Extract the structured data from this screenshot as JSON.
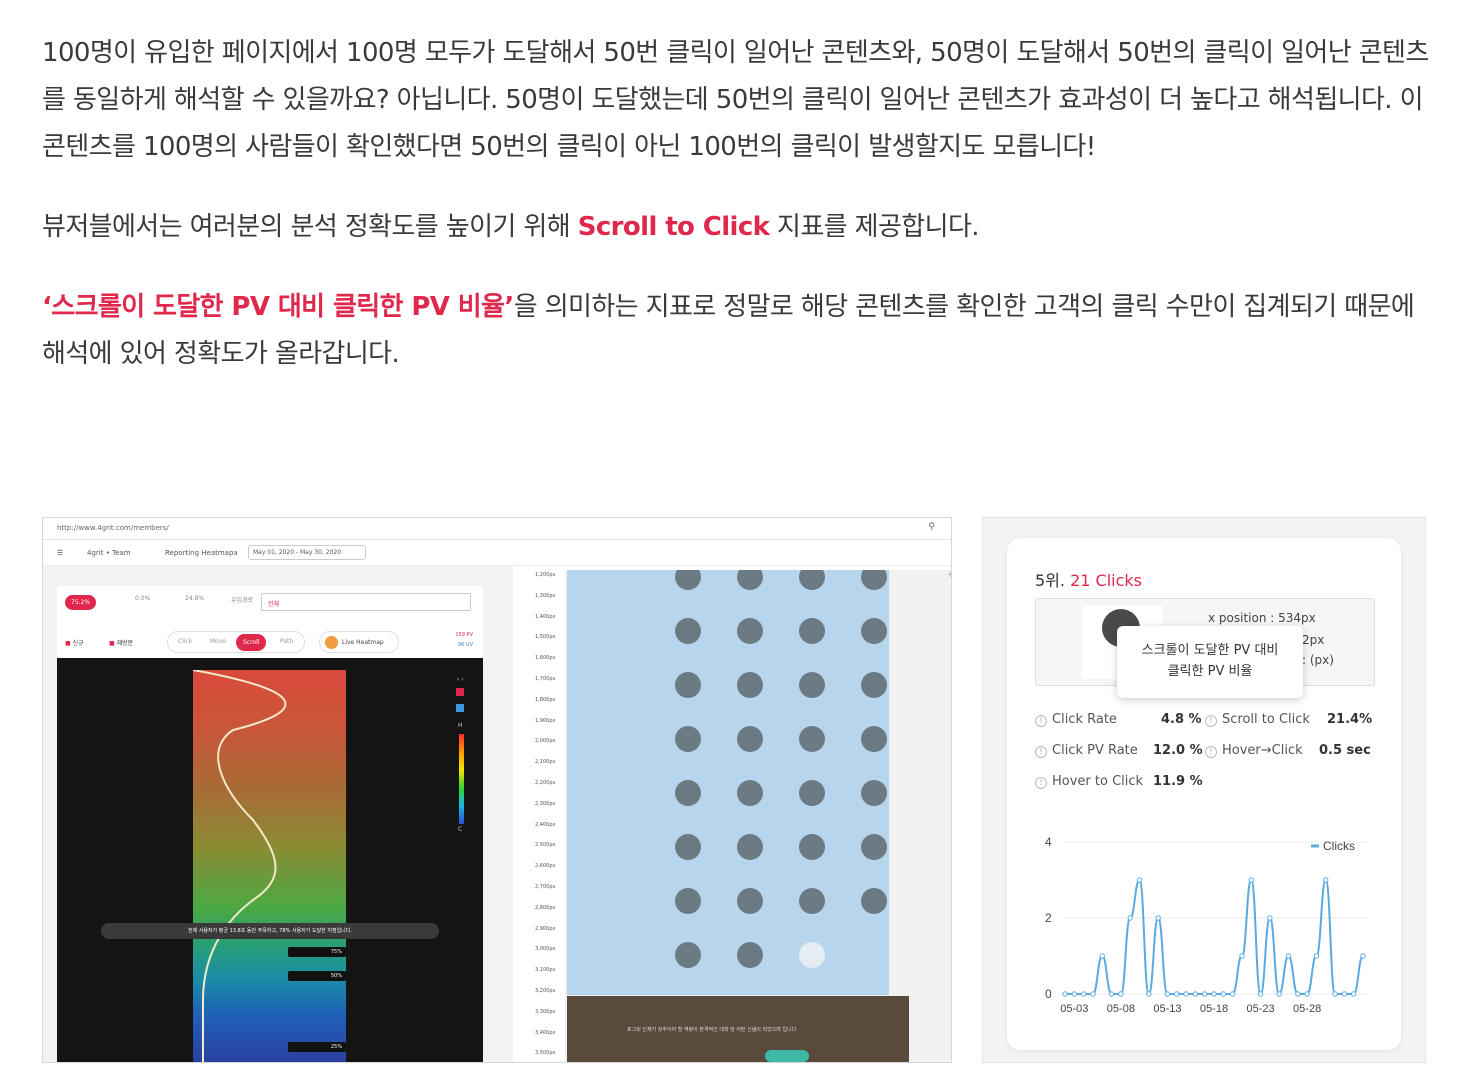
{
  "article": {
    "p1": "100명이 유입한 페이지에서 100명 모두가 도달해서 50번 클릭이 일어난 콘텐츠와, 50명이 도달해서 50번의 클릭이 일어난 콘텐츠를 동일하게 해석할 수 있을까요? 아닙니다. 50명이 도달했는데 50번의 클릭이 일어난 콘텐츠가 효과성이 더 높다고 해석됩니다. 이 콘텐츠를 100명의 사람들이 확인했다면 50번의 클릭이 아닌 100번의 클릭이 발생할지도 모릅니다!",
    "p2_before": "뷰저블에서는 여러분의 분석 정확도를 높이기 위해 ",
    "p2_accent": "Scroll to Click",
    "p2_after": " 지표를 제공합니다.",
    "p3_accent": "‘스크롤이 도달한 PV 대비 클릭한 PV 비율’",
    "p3_after": "을 의미하는 지표로 정말로 해당 콘텐츠를 확인한 고객의 클릭 수만이 집계되기 때문에 해석에 있어 정확도가 올라갑니다.",
    "accent_color": "#e0284c"
  },
  "left_shot": {
    "url": "http://www.4grit.com/members/",
    "crumb_workspace": "4grit • Team",
    "crumb_page": "Reporting Heatmapa",
    "date_range": "May 01, 2020 - May 30, 2020",
    "chips": [
      "75.2%",
      "0.0%",
      "24.8%"
    ],
    "select_label": "유입경로",
    "select_value": "전체",
    "check_new": "신규",
    "check_revisit": "재방문",
    "tabs": [
      "Click",
      "Move",
      "Scroll",
      "Path"
    ],
    "active_tab": "Scroll",
    "live_heatmap": "Live Heatmap",
    "pv": "159 PV",
    "uv": "96 UV",
    "heatmap_tooltip": "전체 사용자가 평균 13.8초 동안 주목하고, 78% 사용자가 도달한 지점입니다.",
    "marks": [
      "75%",
      "50%",
      "25%"
    ],
    "legend_hi": "H",
    "legend_lo": "C",
    "ruler": [
      "1,200px",
      "1,300px",
      "1,400px",
      "1,500px",
      "1,600px",
      "1,700px",
      "1,800px",
      "1,900px",
      "2,000px",
      "2,100px",
      "2,200px",
      "2,300px",
      "2,400px",
      "2,500px",
      "2,600px",
      "2,700px",
      "2,800px",
      "2,900px",
      "3,000px",
      "3,100px",
      "3,200px",
      "3,300px",
      "3,400px",
      "3,500px"
    ],
    "footer_caption": "포그릿 인재가 갖추어야 할 역량이 본격적인 대학 당 어떤 신념이 되었으며 입니다"
  },
  "right_shot": {
    "rank_prefix": "5위.",
    "rank_clicks": "21 Clicks",
    "x_position": "x position : 534px",
    "y_partial": "2px",
    "unit_partial": ": (px)",
    "tooltip_line1": "스크롤이 도달한 PV 대비",
    "tooltip_line2": "클릭한 PV 비율",
    "metrics": [
      {
        "label": "Click Rate",
        "value": "4.8 %"
      },
      {
        "label": "Scroll to Click",
        "value": "21.4%"
      },
      {
        "label": "Click PV Rate",
        "value": "12.0 %"
      },
      {
        "label": "Hover→Click",
        "value": "0.5 sec"
      },
      {
        "label": "Hover to Click",
        "value": "11.9 %"
      }
    ],
    "info_glyph": "!"
  },
  "chart_data": {
    "type": "line",
    "series": [
      {
        "name": "Clicks",
        "values": [
          0,
          0,
          0,
          0,
          1,
          0,
          0,
          2,
          3,
          0,
          2,
          0,
          0,
          0,
          0,
          0,
          0,
          0,
          0,
          1,
          3,
          0,
          2,
          0,
          1,
          0,
          0,
          1,
          3,
          0,
          0,
          0,
          1
        ]
      }
    ],
    "x_ticks": [
      "05-03",
      "05-08",
      "05-13",
      "05-18",
      "05-23",
      "05-28"
    ],
    "y_ticks": [
      0,
      2,
      4
    ],
    "ylim": [
      0,
      4
    ],
    "legend": "top-right",
    "color": "#5aa9e0"
  }
}
